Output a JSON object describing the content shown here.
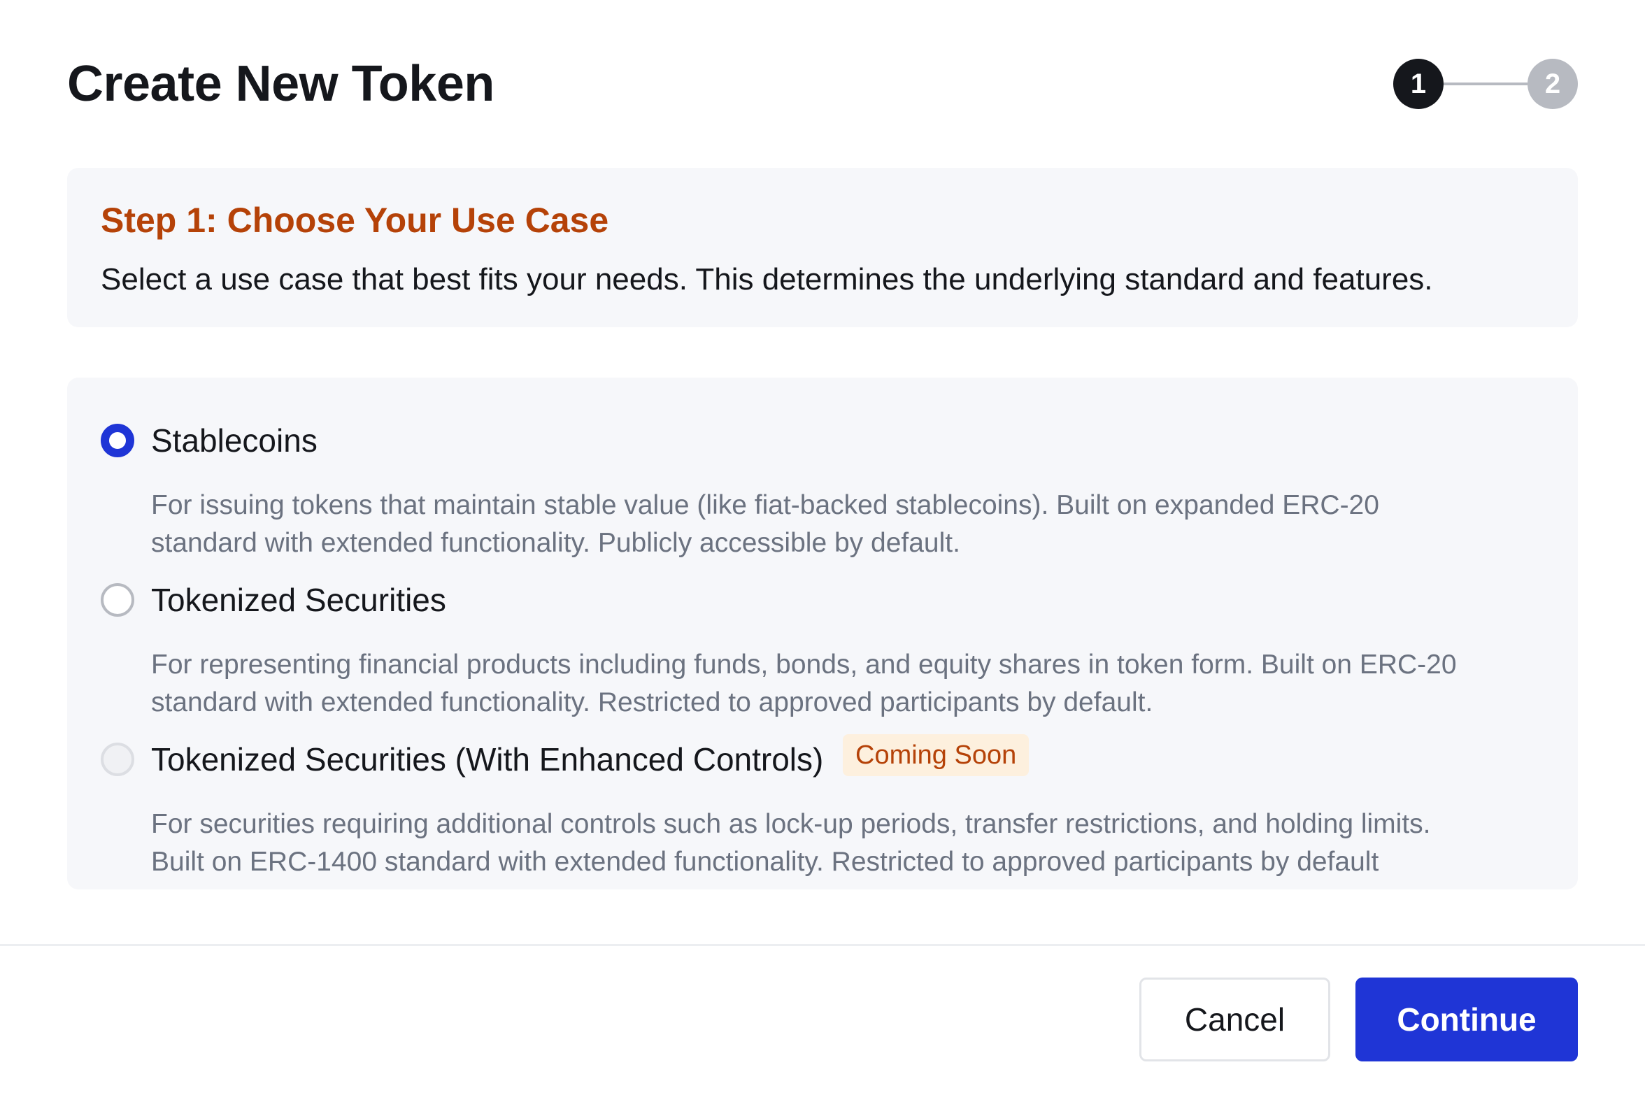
{
  "modal": {
    "title": "Create New Token"
  },
  "stepper": {
    "steps": [
      {
        "label": "1",
        "state": "active"
      },
      {
        "label": "2",
        "state": "inactive"
      }
    ]
  },
  "intro": {
    "heading": "Step 1: Choose Your Use Case",
    "text": "Select a use case that best fits your needs. This determines the underlying standard and features."
  },
  "options": [
    {
      "title": "Stablecoins",
      "selected": true,
      "disabled": false,
      "badge": "",
      "description": [
        "For issuing tokens that maintain stable value (like fiat-backed stablecoins). Built on expanded ERC-20",
        "standard with extended functionality. Publicly accessible by default."
      ]
    },
    {
      "title": "Tokenized Securities",
      "selected": false,
      "disabled": false,
      "badge": "",
      "description": [
        "For representing financial products including funds, bonds, and equity shares in token form. Built on ERC-20",
        "standard with extended functionality. Restricted to approved participants by default."
      ]
    },
    {
      "title": "Tokenized Securities (With Enhanced Controls)",
      "selected": false,
      "disabled": true,
      "badge": "Coming Soon",
      "description": [
        "For securities requiring additional controls such as lock-up periods, transfer restrictions, and holding limits.",
        "Built on ERC-1400 standard with extended functionality. Restricted to approved participants by default"
      ]
    }
  ],
  "footer": {
    "cancel_label": "Cancel",
    "continue_label": "Continue"
  },
  "colors": {
    "accent": "#1f35d6",
    "heading_orange": "#b54208",
    "badge_bg": "#fdf0de",
    "panel_bg": "#f6f7fa"
  }
}
